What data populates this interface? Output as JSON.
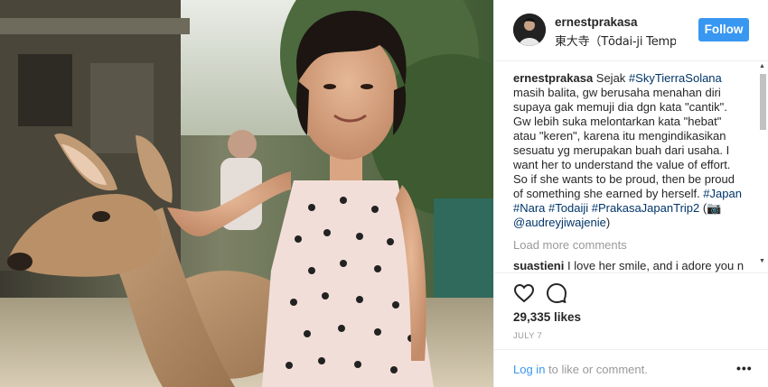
{
  "post": {
    "username": "ernestprakasa",
    "location": "東大寺（Tōdai-ji Templ…",
    "follow_label": "Follow"
  },
  "caption": {
    "username": "ernestprakasa",
    "p1": " Sejak ",
    "tag1": "#SkyTierraSolana",
    "p2": " masih balita, gw berusaha menahan diri supaya gak memuji dia dgn kata \"cantik\". Gw lebih suka melontarkan kata \"hebat\" atau \"keren\", karena itu mengindikasikan sesuatu yg merupakan buah dari usaha. I want her to understand the value of effort. So if she wants to be proud, then be proud of something she earned by herself. ",
    "tag2": "#Japan",
    "tag3": "#Nara",
    "tag4": "#Todaiji",
    "tag5": "#PrakasaJapanTrip2",
    "p3": " (📷 ",
    "mention": "@audreyjiwajenie",
    "p4": ")"
  },
  "comments": {
    "load_more": "Load more comments",
    "items": [
      {
        "username": "suastieni",
        "text": " I love her smile, and i adore you n"
      }
    ]
  },
  "stats": {
    "likes": "29,335 likes",
    "date": "JULY 7"
  },
  "footer": {
    "login_link": "Log in",
    "login_rest": " to like or comment.",
    "more_label": "•••"
  },
  "icons": {
    "like": "heart-icon",
    "comment": "comment-icon",
    "more": "more-options-icon"
  },
  "colors": {
    "follow_bg": "#3897f0",
    "hashtag": "#003569",
    "muted": "#999999"
  }
}
